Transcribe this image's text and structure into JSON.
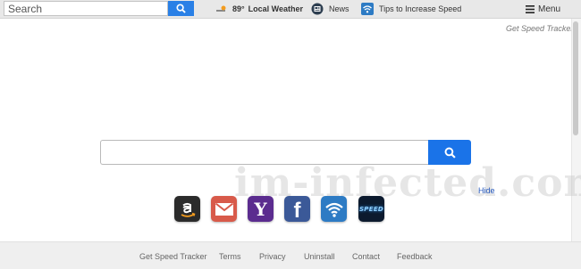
{
  "toolbar": {
    "search_placeholder": "Search",
    "weather_temp": "89°",
    "weather_label": "Local Weather",
    "news_label": "News",
    "tips_label": "Tips to Increase Speed",
    "menu_label": "Menu"
  },
  "tagline": "Get Speed Tracker",
  "main": {
    "hide_label": "Hide",
    "watermark": "im-infected.com"
  },
  "shortcuts": [
    {
      "name": "amazon",
      "icon": "amazon-icon"
    },
    {
      "name": "gmail",
      "icon": "mail-icon"
    },
    {
      "name": "yahoo",
      "icon": "yahoo-icon"
    },
    {
      "name": "facebook",
      "icon": "facebook-icon"
    },
    {
      "name": "wifi",
      "icon": "wifi-icon"
    },
    {
      "name": "speed",
      "icon": "speed-icon"
    }
  ],
  "shortcut_text": {
    "yahoo": "Y",
    "facebook": "f",
    "speed": "SPEED"
  },
  "footer": {
    "links": [
      "Get Speed Tracker",
      "Terms",
      "Privacy",
      "Uninstall",
      "Contact",
      "Feedback"
    ]
  },
  "colors": {
    "accent": "#1a73e8",
    "toolbar_bg": "#e8e8e8",
    "footer_bg": "#efefef"
  }
}
